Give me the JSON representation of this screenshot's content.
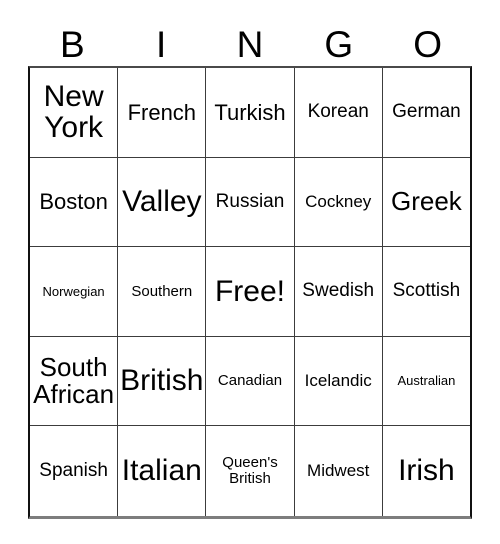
{
  "card": {
    "header_letters": [
      "B",
      "I",
      "N",
      "G",
      "O"
    ],
    "rows": [
      [
        {
          "text": "New\nYork",
          "size": "fs-xxl"
        },
        {
          "text": "French",
          "size": "fs-l"
        },
        {
          "text": "Turkish",
          "size": "fs-l"
        },
        {
          "text": "Korean",
          "size": "fs-m"
        },
        {
          "text": "German",
          "size": "fs-m"
        }
      ],
      [
        {
          "text": "Boston",
          "size": "fs-l"
        },
        {
          "text": "Valley",
          "size": "fs-xxl"
        },
        {
          "text": "Russian",
          "size": "fs-m"
        },
        {
          "text": "Cockney",
          "size": "fs-s"
        },
        {
          "text": "Greek",
          "size": "fs-xl"
        }
      ],
      [
        {
          "text": "Norwegian",
          "size": "fs-xxs"
        },
        {
          "text": "Southern",
          "size": "fs-xs"
        },
        {
          "text": "Free!",
          "size": "fs-xxl"
        },
        {
          "text": "Swedish",
          "size": "fs-m"
        },
        {
          "text": "Scottish",
          "size": "fs-m"
        }
      ],
      [
        {
          "text": "South\nAfrican",
          "size": "fs-xl"
        },
        {
          "text": "British",
          "size": "fs-xxl"
        },
        {
          "text": "Canadian",
          "size": "fs-xs"
        },
        {
          "text": "Icelandic",
          "size": "fs-s"
        },
        {
          "text": "Australian",
          "size": "fs-xxs"
        }
      ],
      [
        {
          "text": "Spanish",
          "size": "fs-m"
        },
        {
          "text": "Italian",
          "size": "fs-xxl"
        },
        {
          "text": "Queen's\nBritish",
          "size": "fs-xs"
        },
        {
          "text": "Midwest",
          "size": "fs-s"
        },
        {
          "text": "Irish",
          "size": "fs-xxl"
        }
      ]
    ]
  },
  "colors": {
    "grid_line": "#3c3c3c",
    "outer_border": "#111111",
    "cell_background": "#ffffff",
    "text": "#000000"
  }
}
